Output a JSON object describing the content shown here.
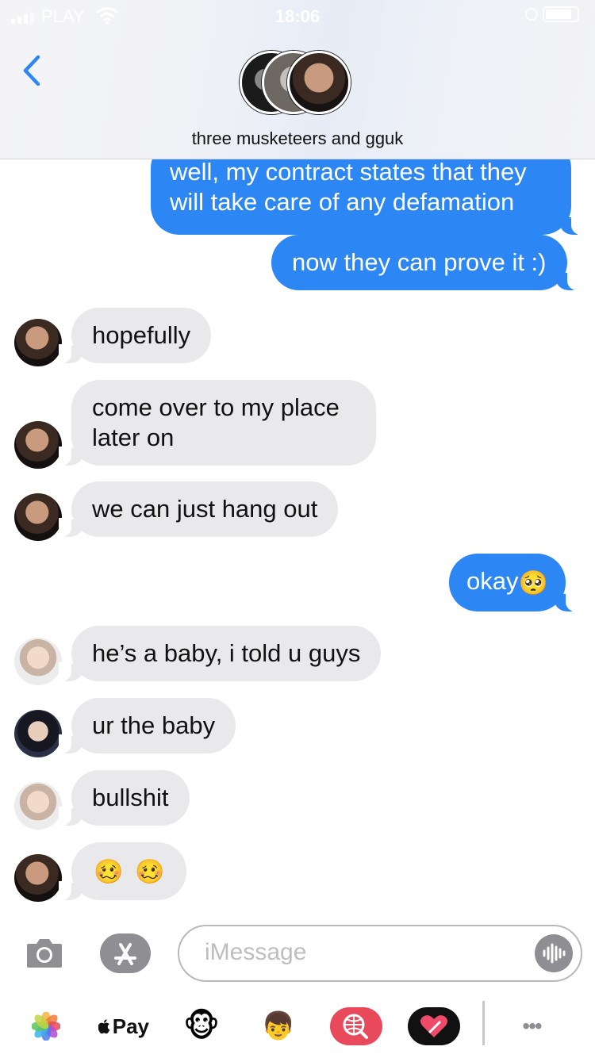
{
  "status": {
    "carrier": "PLAY",
    "time": "18:06"
  },
  "conversation": {
    "title": "three musketeers and gguk"
  },
  "messages": [
    {
      "dir": "out",
      "text": "well, my contract states that they will take care of any defamation"
    },
    {
      "dir": "out",
      "text": "now they can prove it :)"
    },
    {
      "dir": "in",
      "avatar": "avatar-jungkook",
      "text": "hopefully"
    },
    {
      "dir": "in",
      "avatar": "avatar-jungkook",
      "text": "come over to my place later on"
    },
    {
      "dir": "in",
      "avatar": "avatar-jungkook",
      "text": "we can just hang out"
    },
    {
      "dir": "out",
      "text": "okay",
      "emoji": "pleading-face"
    },
    {
      "dir": "in",
      "avatar": "avatar-blonde",
      "text": "he’s a baby, i told u guys"
    },
    {
      "dir": "in",
      "avatar": "avatar-dark-hair",
      "text": "ur the baby"
    },
    {
      "dir": "in",
      "avatar": "avatar-blonde",
      "text": "bullshit"
    },
    {
      "dir": "in",
      "avatar": "avatar-jungkook",
      "emoji": [
        "woozy-face",
        "woozy-face"
      ]
    }
  ],
  "composer": {
    "placeholder": "iMessage"
  },
  "app_drawer": {
    "apple_pay_label": "Pay",
    "more_label": "•••"
  },
  "colors": {
    "outgoing_bubble": "#2c86f4",
    "incoming_bubble": "#e9e9ec",
    "accent": "#2c86f4"
  }
}
